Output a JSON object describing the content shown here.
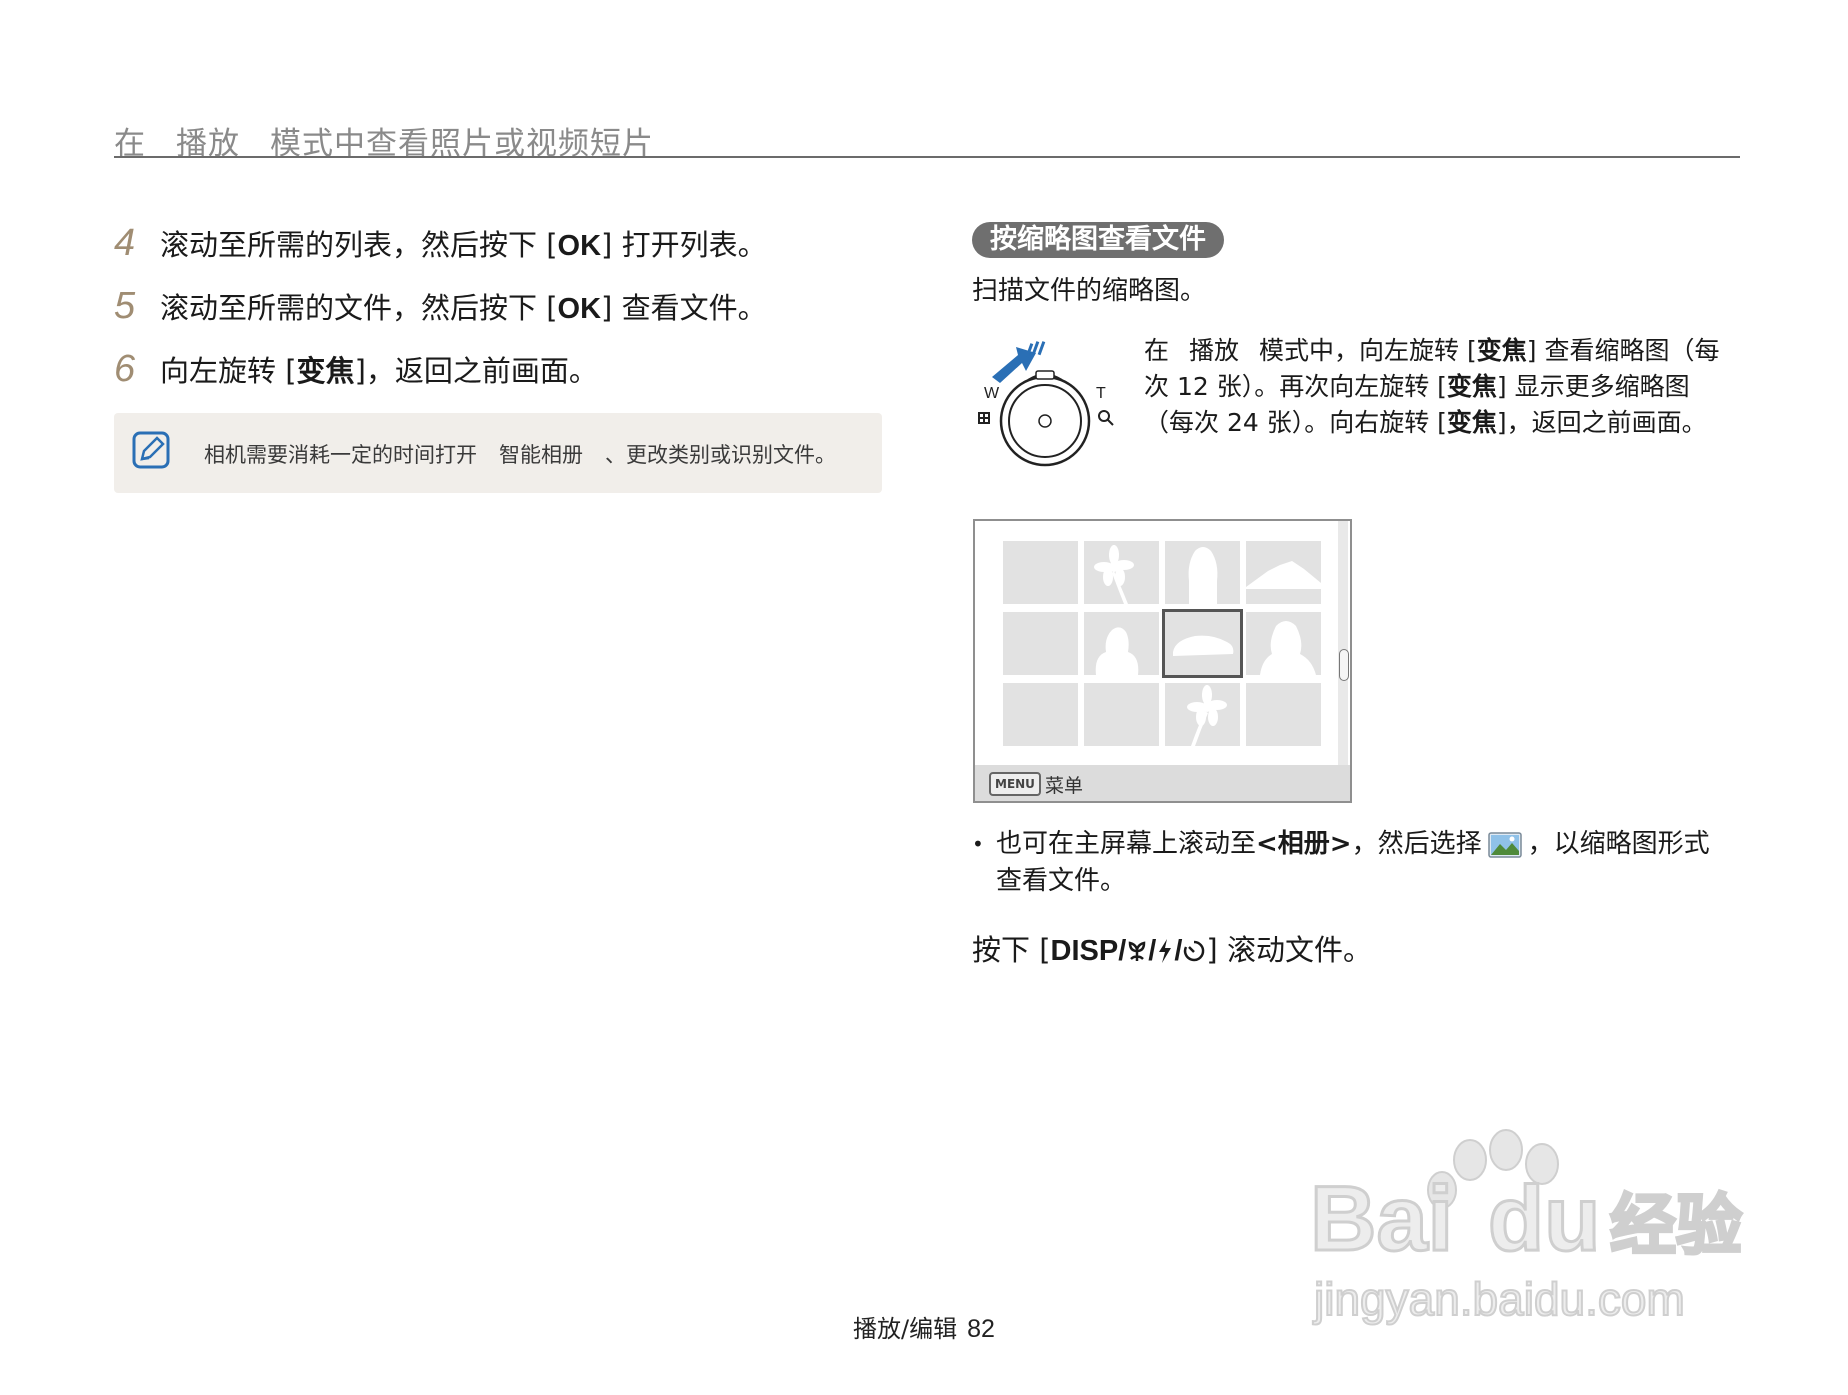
{
  "header": {
    "part1": "在",
    "part2": "播放",
    "part3": "模式中查看照片或视频短片"
  },
  "steps": [
    {
      "num": "4",
      "pre": "滚动至所需的列表，然后按下 [",
      "key": "OK",
      "post": "] 打开列表。"
    },
    {
      "num": "5",
      "pre": "滚动至所需的文件，然后按下 [",
      "key": "OK",
      "post": "] 查看文件。"
    },
    {
      "num": "6",
      "pre": "向左旋转 [",
      "key": "变焦",
      "post": "]，返回之前画面。"
    }
  ],
  "note": {
    "part1": "相机需要消耗一定的时间打开",
    "part2": "智能相册",
    "part3": "、更改类别或识别文件。"
  },
  "section": {
    "title": "按缩略图查看文件",
    "subtitle": "扫描文件的缩略图。"
  },
  "dial": {
    "label_w": "W",
    "label_t": "T",
    "desc": {
      "a": "在",
      "b": "播放",
      "c": "模式中，向左旋转 [",
      "k1": "变焦",
      "d": "] 查看缩略图（每次 12 张）。再次向左旋转 [",
      "k2": "变焦",
      "e": "] 显示更多缩略图（每次 24 张）。向右旋转 [",
      "k3": "变焦",
      "f": "]，返回之前画面。"
    }
  },
  "screen": {
    "menu_key": "MENU",
    "menu_label": "菜单"
  },
  "bullet": {
    "a": "也可在主屏幕上滚动至",
    "album": "<相册>",
    "b": "，然后选择",
    "c": "，以缩略图形式查看文件。"
  },
  "scroll": {
    "pre": "按下 [",
    "key": "DISP/",
    "post": "] 滚动文件。"
  },
  "footer": {
    "section": "播放/编辑",
    "page": "82"
  },
  "watermark": {
    "brand": "Bai",
    "brand2": "du",
    "cn": "经验",
    "url": "jingyan.baidu.com"
  },
  "colors": {
    "step_number": "#a08d73",
    "pill_bg": "#6f6f6f",
    "note_bg": "#f1eeea",
    "note_icon": "#2a6fb5",
    "dial_arrow": "#2a6fb5"
  }
}
